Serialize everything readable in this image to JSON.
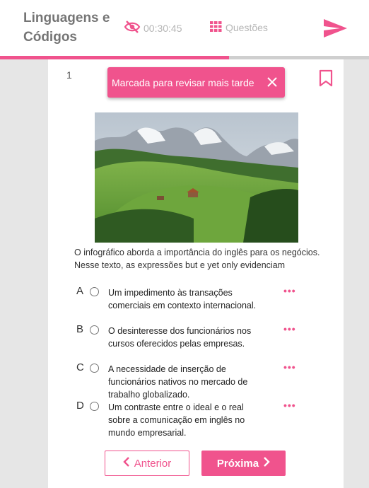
{
  "header": {
    "title": "Linguagens e Códigos",
    "timer": "00:30:45",
    "questoes_label": "Questões",
    "progress_fraction": 0.62
  },
  "question": {
    "number": "1",
    "toast_text": "Marcada para revisar mais tarde",
    "stem": "O infográfico aborda a importância do inglês para os negócios. Nesse texto, as expressões but e yet only evidenciam",
    "alternatives": [
      {
        "letter": "A",
        "text": "Um impedimento às transações comerciais em contexto internacional."
      },
      {
        "letter": "B",
        "text": "O desinteresse dos funcionários nos cursos oferecidos pelas empresas."
      },
      {
        "letter": "C",
        "text": "A necessidade de inserção de funcionários nativos no mercado de trabalho globalizado."
      },
      {
        "letter": "D",
        "text": "Um contraste entre o ideal e o real sobre a comunicação em inglês no mundo empresarial."
      }
    ],
    "more_glyph": "•••"
  },
  "nav": {
    "prev_label": "Anterior",
    "next_label": "Próxima"
  },
  "colors": {
    "accent": "#f0538d",
    "muted": "#b5b5b5",
    "title": "#757575"
  },
  "icons": {
    "visibility": "eye-off-icon",
    "grid": "grid-icon",
    "send": "send-icon",
    "bookmark": "bookmark-icon",
    "close": "close-icon"
  }
}
